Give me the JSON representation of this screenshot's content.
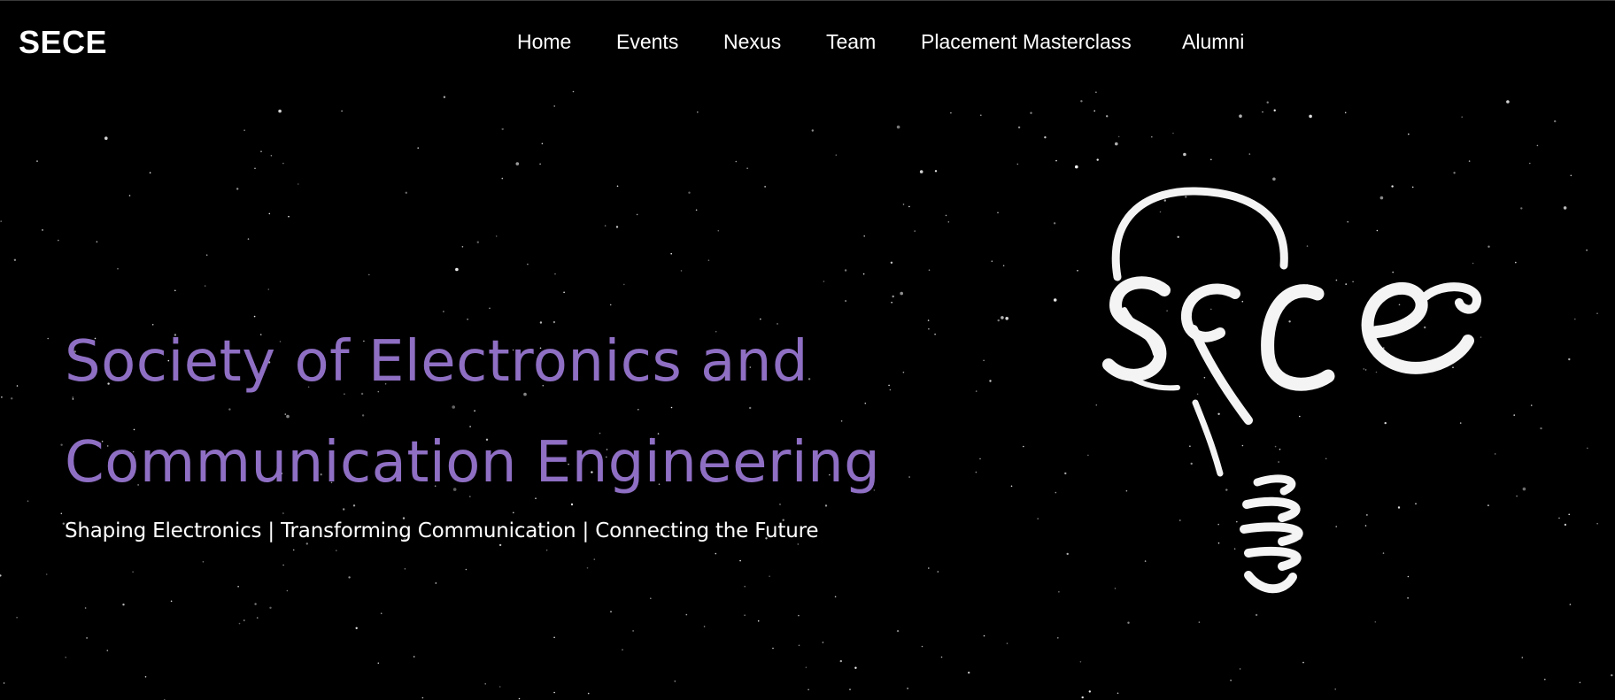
{
  "navbar": {
    "brand": "SECE",
    "links": [
      "Home",
      "Events",
      "Nexus",
      "Team",
      "Placement Masterclass",
      "Alumni"
    ]
  },
  "hero": {
    "title_line1": "Society of Electronics and",
    "title_line2": "Communication Engineering",
    "subtitle": "Shaping Electronics | Transforming Communication | Connecting the Future"
  },
  "logo": {
    "text": "SECE",
    "icon": "lightbulb-logo-icon"
  },
  "colors": {
    "background": "#000000",
    "accent": "#8e6fc3",
    "text": "#ffffff"
  }
}
